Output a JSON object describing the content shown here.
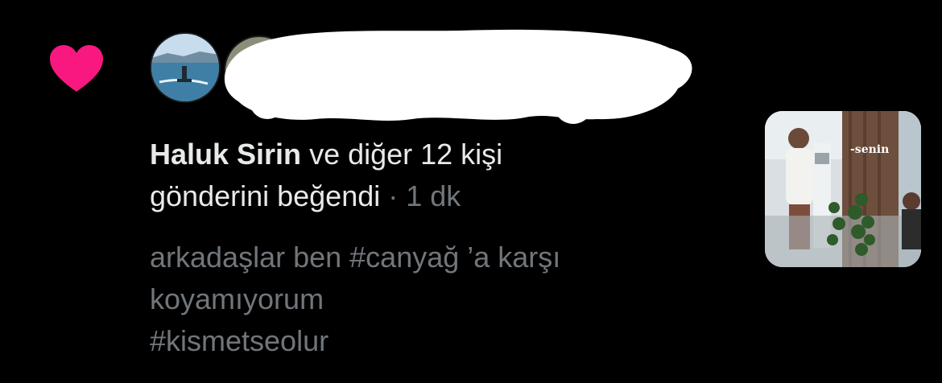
{
  "colors": {
    "background": "#000000",
    "heart": "#f91880",
    "primary_text": "#e7e9ea",
    "secondary_text": "#71767b"
  },
  "icons": {
    "like": "heart-icon"
  },
  "notification": {
    "actor_name": "Haluk Sirin",
    "summary_suffix": " ve diğer 12 kişi",
    "summary_line2": "gönderini beğendi",
    "separator": " · ",
    "time": "1 dk",
    "tweet_lines": [
      "arkadaşlar ben #canyağ ’a karşı",
      "koyamıyorum",
      "#kismetseolur"
    ],
    "thumbnail_caption": "-senin"
  }
}
